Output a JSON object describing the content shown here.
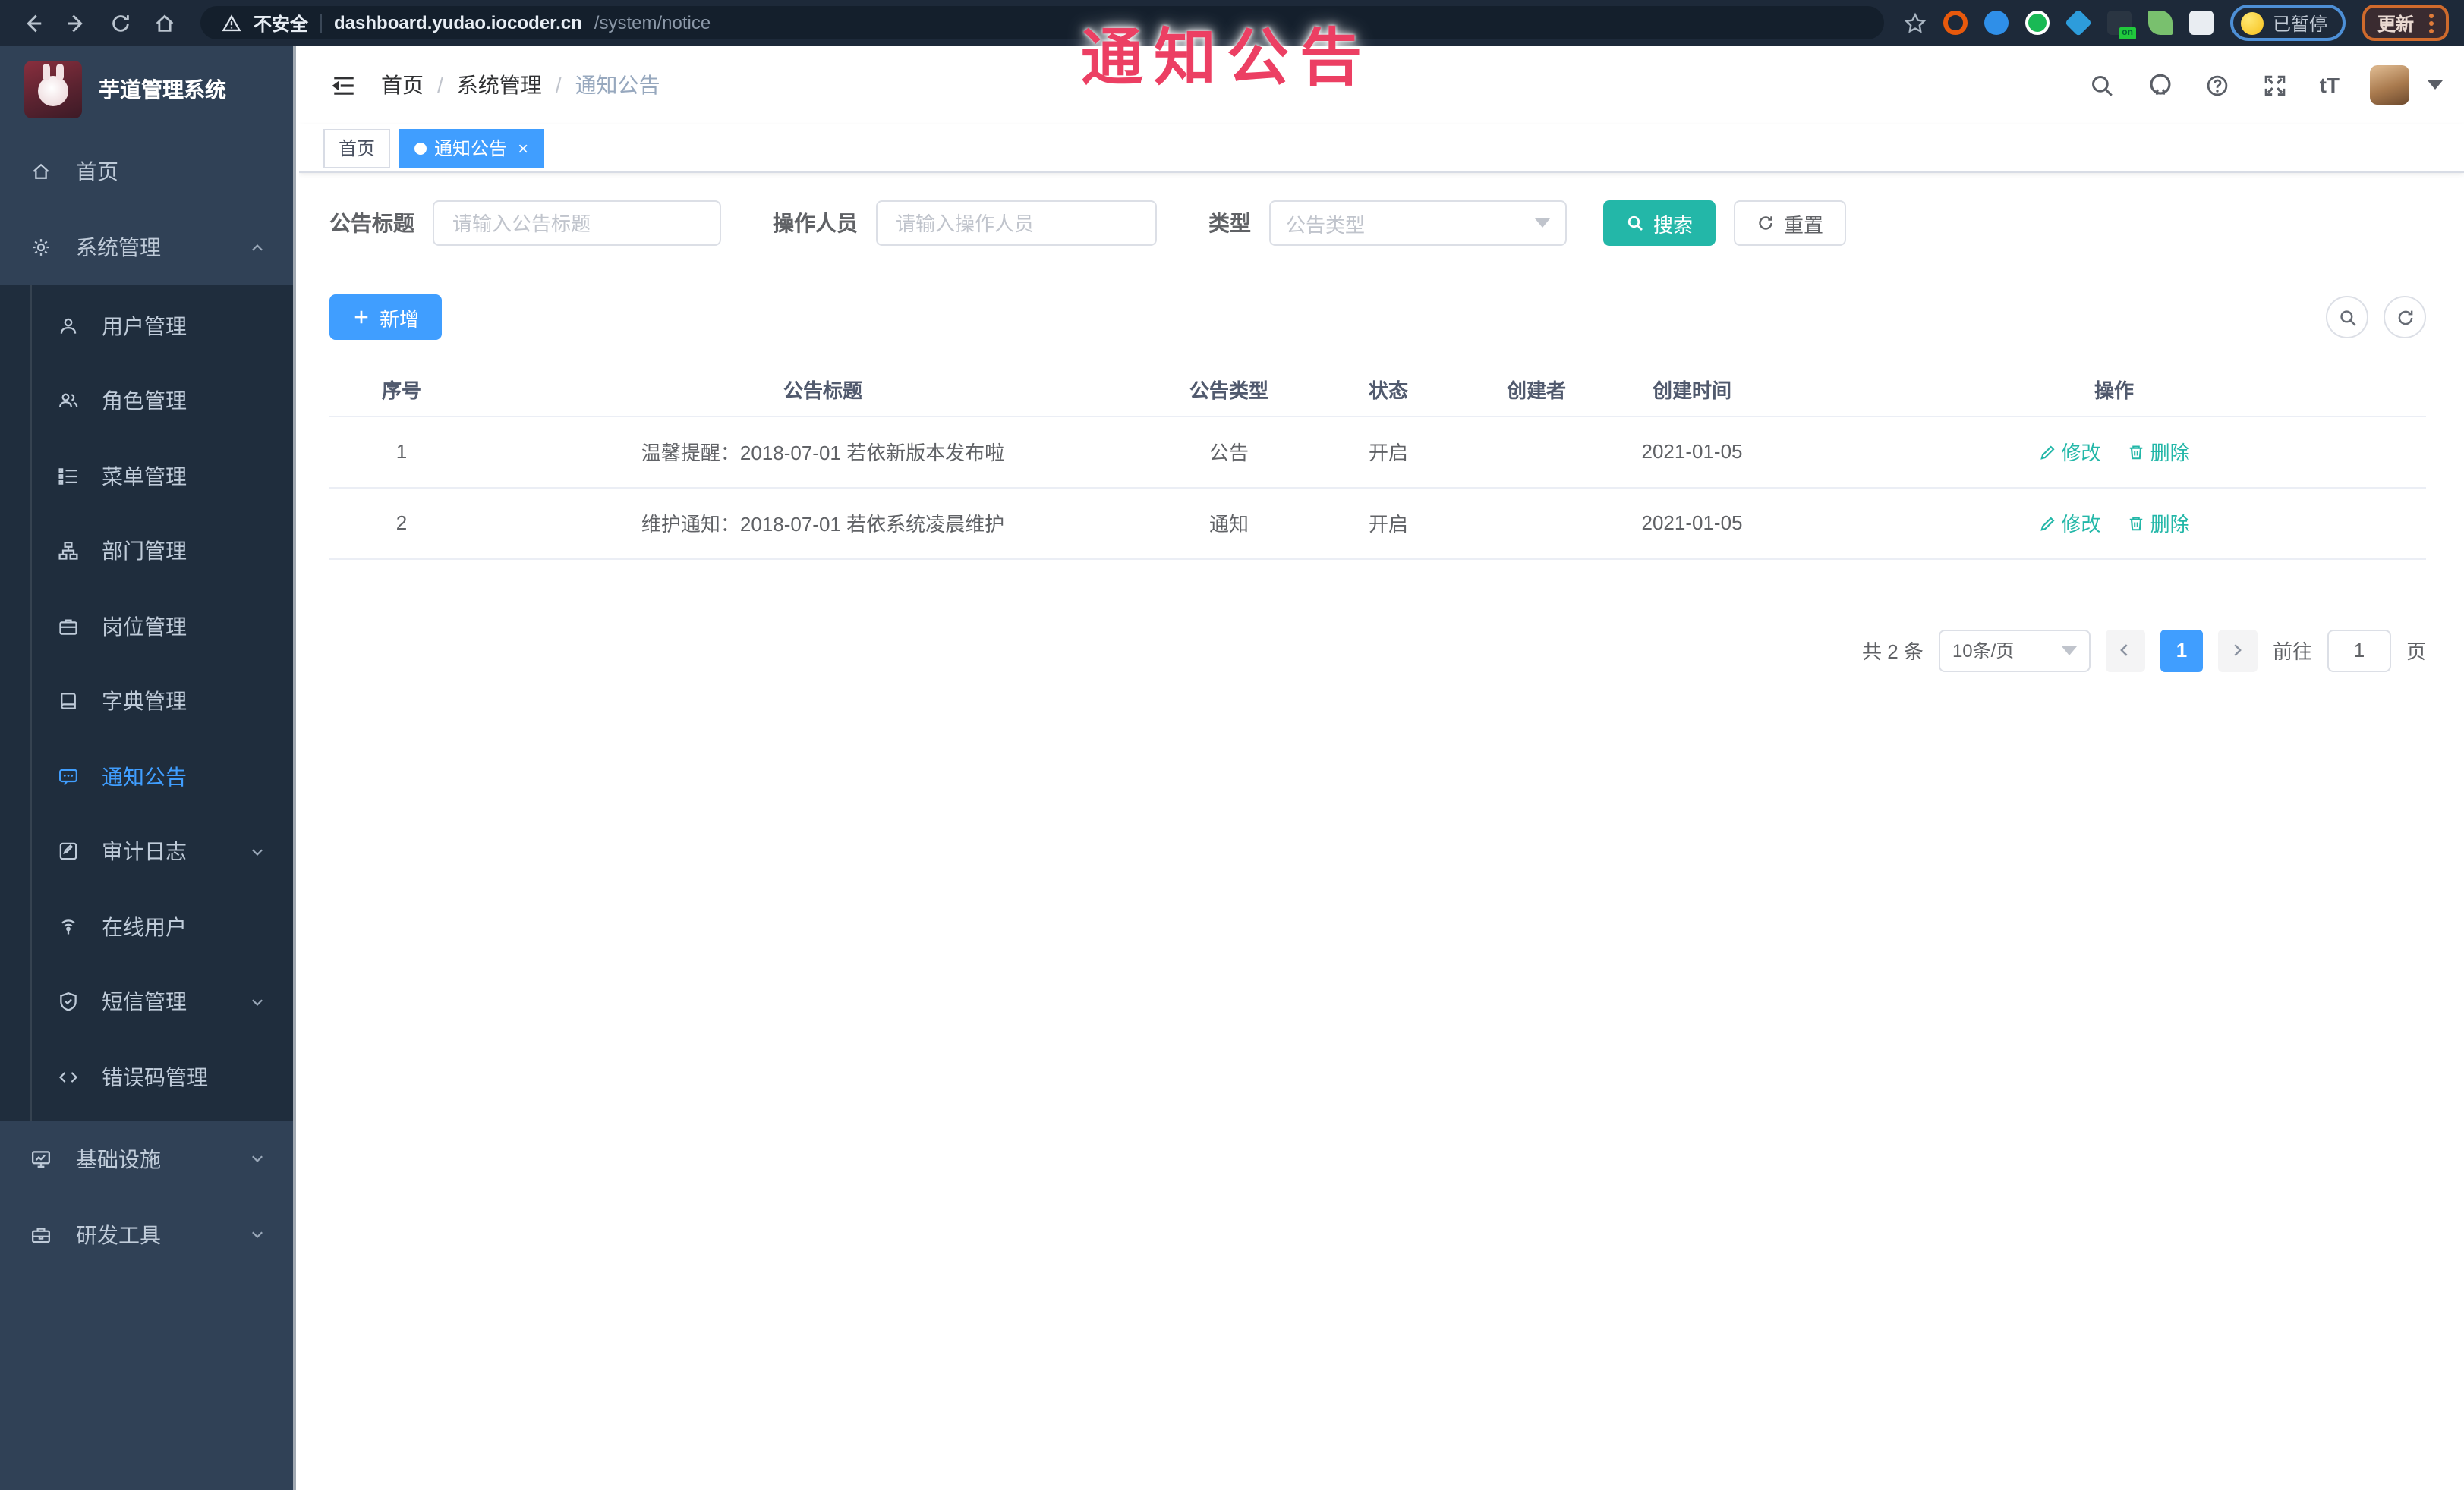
{
  "browser": {
    "security_warning": "不安全",
    "url_host": "dashboard.yudao.iocoder.cn",
    "url_path": "/system/notice",
    "extension_badge": "on",
    "paused_badge": "已暂停",
    "update_button": "更新"
  },
  "overlay": {
    "title": "通知公告"
  },
  "sidebar": {
    "app_title": "芋道管理系统",
    "home_label": "首页",
    "system_label": "系统管理",
    "system_children": [
      {
        "label": "用户管理"
      },
      {
        "label": "角色管理"
      },
      {
        "label": "菜单管理"
      },
      {
        "label": "部门管理"
      },
      {
        "label": "岗位管理"
      },
      {
        "label": "字典管理"
      },
      {
        "label": "通知公告",
        "active": true
      },
      {
        "label": "审计日志",
        "expandable": true
      },
      {
        "label": "在线用户"
      },
      {
        "label": "短信管理",
        "expandable": true
      },
      {
        "label": "错误码管理"
      }
    ],
    "infra_label": "基础设施",
    "devtools_label": "研发工具"
  },
  "header": {
    "breadcrumb": [
      "首页",
      "系统管理",
      "通知公告"
    ],
    "separator": "/"
  },
  "tabs": [
    {
      "label": "首页",
      "active": false
    },
    {
      "label": "通知公告",
      "active": true,
      "closable": true
    }
  ],
  "filters": {
    "title_label": "公告标题",
    "title_placeholder": "请输入公告标题",
    "operator_label": "操作人员",
    "operator_placeholder": "请输入操作人员",
    "type_label": "类型",
    "type_placeholder": "公告类型",
    "search_button": "搜索",
    "reset_button": "重置"
  },
  "toolbar": {
    "add_button": "新增"
  },
  "table": {
    "columns": [
      "序号",
      "公告标题",
      "公告类型",
      "状态",
      "创建者",
      "创建时间",
      "操作"
    ],
    "rows": [
      {
        "no": "1",
        "title": "温馨提醒：2018-07-01 若依新版本发布啦",
        "type": "公告",
        "status": "开启",
        "creator": "",
        "created_at": "2021-01-05"
      },
      {
        "no": "2",
        "title": "维护通知：2018-07-01 若依系统凌晨维护",
        "type": "通知",
        "status": "开启",
        "creator": "",
        "created_at": "2021-01-05"
      }
    ],
    "actions": {
      "edit": "修改",
      "delete": "删除"
    }
  },
  "pagination": {
    "total": "共 2 条",
    "page_size": "10条/页",
    "current_page": "1",
    "goto_label": "前往",
    "goto_value": "1",
    "page_unit": "页"
  },
  "icons": {
    "chrome_left": [
      "back-icon",
      "forward-icon",
      "reload-icon",
      "home-icon"
    ],
    "header_right": [
      "search-icon",
      "github-icon",
      "help-icon",
      "fullscreen-icon",
      "font-size-icon",
      "avatar",
      "caret-down-icon"
    ],
    "row_actions": [
      "edit-pencil-icon",
      "delete-trash-icon"
    ]
  },
  "colors": {
    "primary_blue": "#409eff",
    "action_teal": "#23b7a8",
    "overlay_red": "#ec3f63",
    "sidebar_bg": "#304156",
    "submenu_bg": "#1f2d3d",
    "chrome_bg": "#1d2939"
  }
}
